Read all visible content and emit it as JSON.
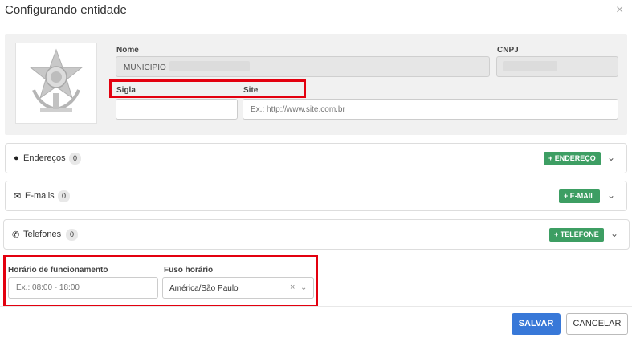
{
  "modal": {
    "title": "Configurando entidade",
    "close_label": "×"
  },
  "entity": {
    "name_label": "Nome",
    "name_value": "MUNICIPIO",
    "cnpj_label": "CNPJ",
    "sigla_label": "Sigla",
    "sigla_value": "",
    "site_label": "Site",
    "site_placeholder": "Ex.: http://www.site.com.br"
  },
  "sections": [
    {
      "icon": "map-marker-icon",
      "glyph": "●",
      "label": "Endereços",
      "count": "0",
      "button": "+ ENDEREÇO"
    },
    {
      "icon": "envelope-icon",
      "glyph": "✉",
      "label": "E-mails",
      "count": "0",
      "button": "+ E-MAIL"
    },
    {
      "icon": "phone-icon",
      "glyph": "✆",
      "label": "Telefones",
      "count": "0",
      "button": "+ TELEFONE"
    }
  ],
  "schedule": {
    "hours_label": "Horário de funcionamento",
    "hours_placeholder": "Ex.: 08:00 - 18:00",
    "timezone_label": "Fuso horário",
    "timezone_value": "América/São Paulo"
  },
  "footer": {
    "save_label": "SALVAR",
    "cancel_label": "CANCELAR"
  },
  "colors": {
    "highlight": "#e3000f",
    "success": "#3d9e63",
    "primary": "#3878d8"
  }
}
